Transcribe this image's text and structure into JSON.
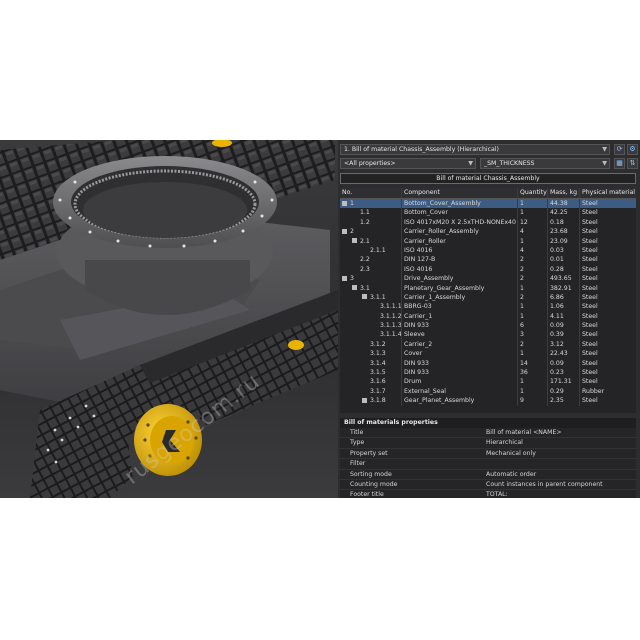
{
  "panel": {
    "view_selector": "1. Bill of material Chassis_Assembly (Hierarchical)",
    "property_filter": "<All properties>",
    "property_field": "_SM_THICKNESS",
    "bom_title": "Bill of material Chassis_Assembly",
    "icons": {
      "refresh": "refresh-icon",
      "settings": "settings-icon",
      "grid": "grid-icon",
      "sort": "sort-icon"
    }
  },
  "bom": {
    "columns": [
      "No.",
      "Component",
      "Quantity",
      "Mass, kg",
      "Physical material"
    ],
    "rows": [
      {
        "no": "1",
        "component": "Bottom_Cover_Assembly",
        "qty": "1",
        "mass": "44.38",
        "material": "Steel",
        "level": 0,
        "expand": true
      },
      {
        "no": "1.1",
        "component": "Bottom_Cover",
        "qty": "1",
        "mass": "42.25",
        "material": "Steel",
        "level": 1,
        "expand": false
      },
      {
        "no": "1.2",
        "component": "ISO 4017xM20 X 2.5xTHD-NONEx40",
        "qty": "12",
        "mass": "0.18",
        "material": "Steel",
        "level": 1,
        "expand": false
      },
      {
        "no": "2",
        "component": "Carrier_Roller_Assembly",
        "qty": "4",
        "mass": "23.68",
        "material": "Steel",
        "level": 0,
        "expand": true
      },
      {
        "no": "2.1",
        "component": "Carrier_Roller",
        "qty": "1",
        "mass": "23.09",
        "material": "Steel",
        "level": 1,
        "expand": true
      },
      {
        "no": "2.1.1",
        "component": "ISO 4016",
        "qty": "4",
        "mass": "0.03",
        "material": "Steel",
        "level": 2,
        "expand": false
      },
      {
        "no": "2.2",
        "component": "DIN 127-B",
        "qty": "2",
        "mass": "0.01",
        "material": "Steel",
        "level": 1,
        "expand": false
      },
      {
        "no": "2.3",
        "component": "ISO 4016",
        "qty": "2",
        "mass": "0.28",
        "material": "Steel",
        "level": 1,
        "expand": false
      },
      {
        "no": "3",
        "component": "Drive_Assembly",
        "qty": "2",
        "mass": "493.65",
        "material": "Steel",
        "level": 0,
        "expand": true
      },
      {
        "no": "3.1",
        "component": "Planetary_Gear_Assembly",
        "qty": "1",
        "mass": "382.91",
        "material": "Steel",
        "level": 1,
        "expand": true
      },
      {
        "no": "3.1.1",
        "component": "Carrier_1_Assembly",
        "qty": "2",
        "mass": "6.86",
        "material": "Steel",
        "level": 2,
        "expand": true
      },
      {
        "no": "3.1.1.1",
        "component": "BBRG-03",
        "qty": "1",
        "mass": "1.06",
        "material": "Steel",
        "level": 3,
        "expand": false
      },
      {
        "no": "3.1.1.2",
        "component": "Carrier_1",
        "qty": "1",
        "mass": "4.11",
        "material": "Steel",
        "level": 3,
        "expand": false
      },
      {
        "no": "3.1.1.3",
        "component": "DIN 933",
        "qty": "6",
        "mass": "0.09",
        "material": "Steel",
        "level": 3,
        "expand": false
      },
      {
        "no": "3.1.1.4",
        "component": "Sleeve",
        "qty": "3",
        "mass": "0.39",
        "material": "Steel",
        "level": 3,
        "expand": false
      },
      {
        "no": "3.1.2",
        "component": "Carrier_2",
        "qty": "2",
        "mass": "3.12",
        "material": "Steel",
        "level": 2,
        "expand": false
      },
      {
        "no": "3.1.3",
        "component": "Cover",
        "qty": "1",
        "mass": "22.43",
        "material": "Steel",
        "level": 2,
        "expand": false
      },
      {
        "no": "3.1.4",
        "component": "DIN 933",
        "qty": "14",
        "mass": "0.09",
        "material": "Steel",
        "level": 2,
        "expand": false
      },
      {
        "no": "3.1.5",
        "component": "DIN 933",
        "qty": "36",
        "mass": "0.23",
        "material": "Steel",
        "level": 2,
        "expand": false
      },
      {
        "no": "3.1.6",
        "component": "Drum",
        "qty": "1",
        "mass": "171.31",
        "material": "Steel",
        "level": 2,
        "expand": false
      },
      {
        "no": "3.1.7",
        "component": "External_Seal",
        "qty": "1",
        "mass": "0.29",
        "material": "Rubber",
        "level": 2,
        "expand": false
      },
      {
        "no": "3.1.8",
        "component": "Gear_Planet_Assembly",
        "qty": "9",
        "mass": "2.35",
        "material": "Steel",
        "level": 2,
        "expand": true
      }
    ]
  },
  "properties": {
    "heading": "Bill of materials properties",
    "rows": [
      {
        "key": "Title",
        "value": "Bill of material <NAME>"
      },
      {
        "key": "Type",
        "value": "Hierarchical"
      },
      {
        "key": "Property set",
        "value": "Mechanical only"
      },
      {
        "key": "Filter",
        "value": ""
      },
      {
        "key": "Sorting mode",
        "value": "Automatic order"
      },
      {
        "key": "Counting mode",
        "value": "Count instances in parent component"
      },
      {
        "key": "Footer title",
        "value": "TOTAL:"
      }
    ]
  },
  "watermark": "rusgeocom.ru",
  "colors": {
    "selection": "#3d5c84",
    "accent_yellow": "#e8b400",
    "panel_bg": "#2d2d30"
  }
}
